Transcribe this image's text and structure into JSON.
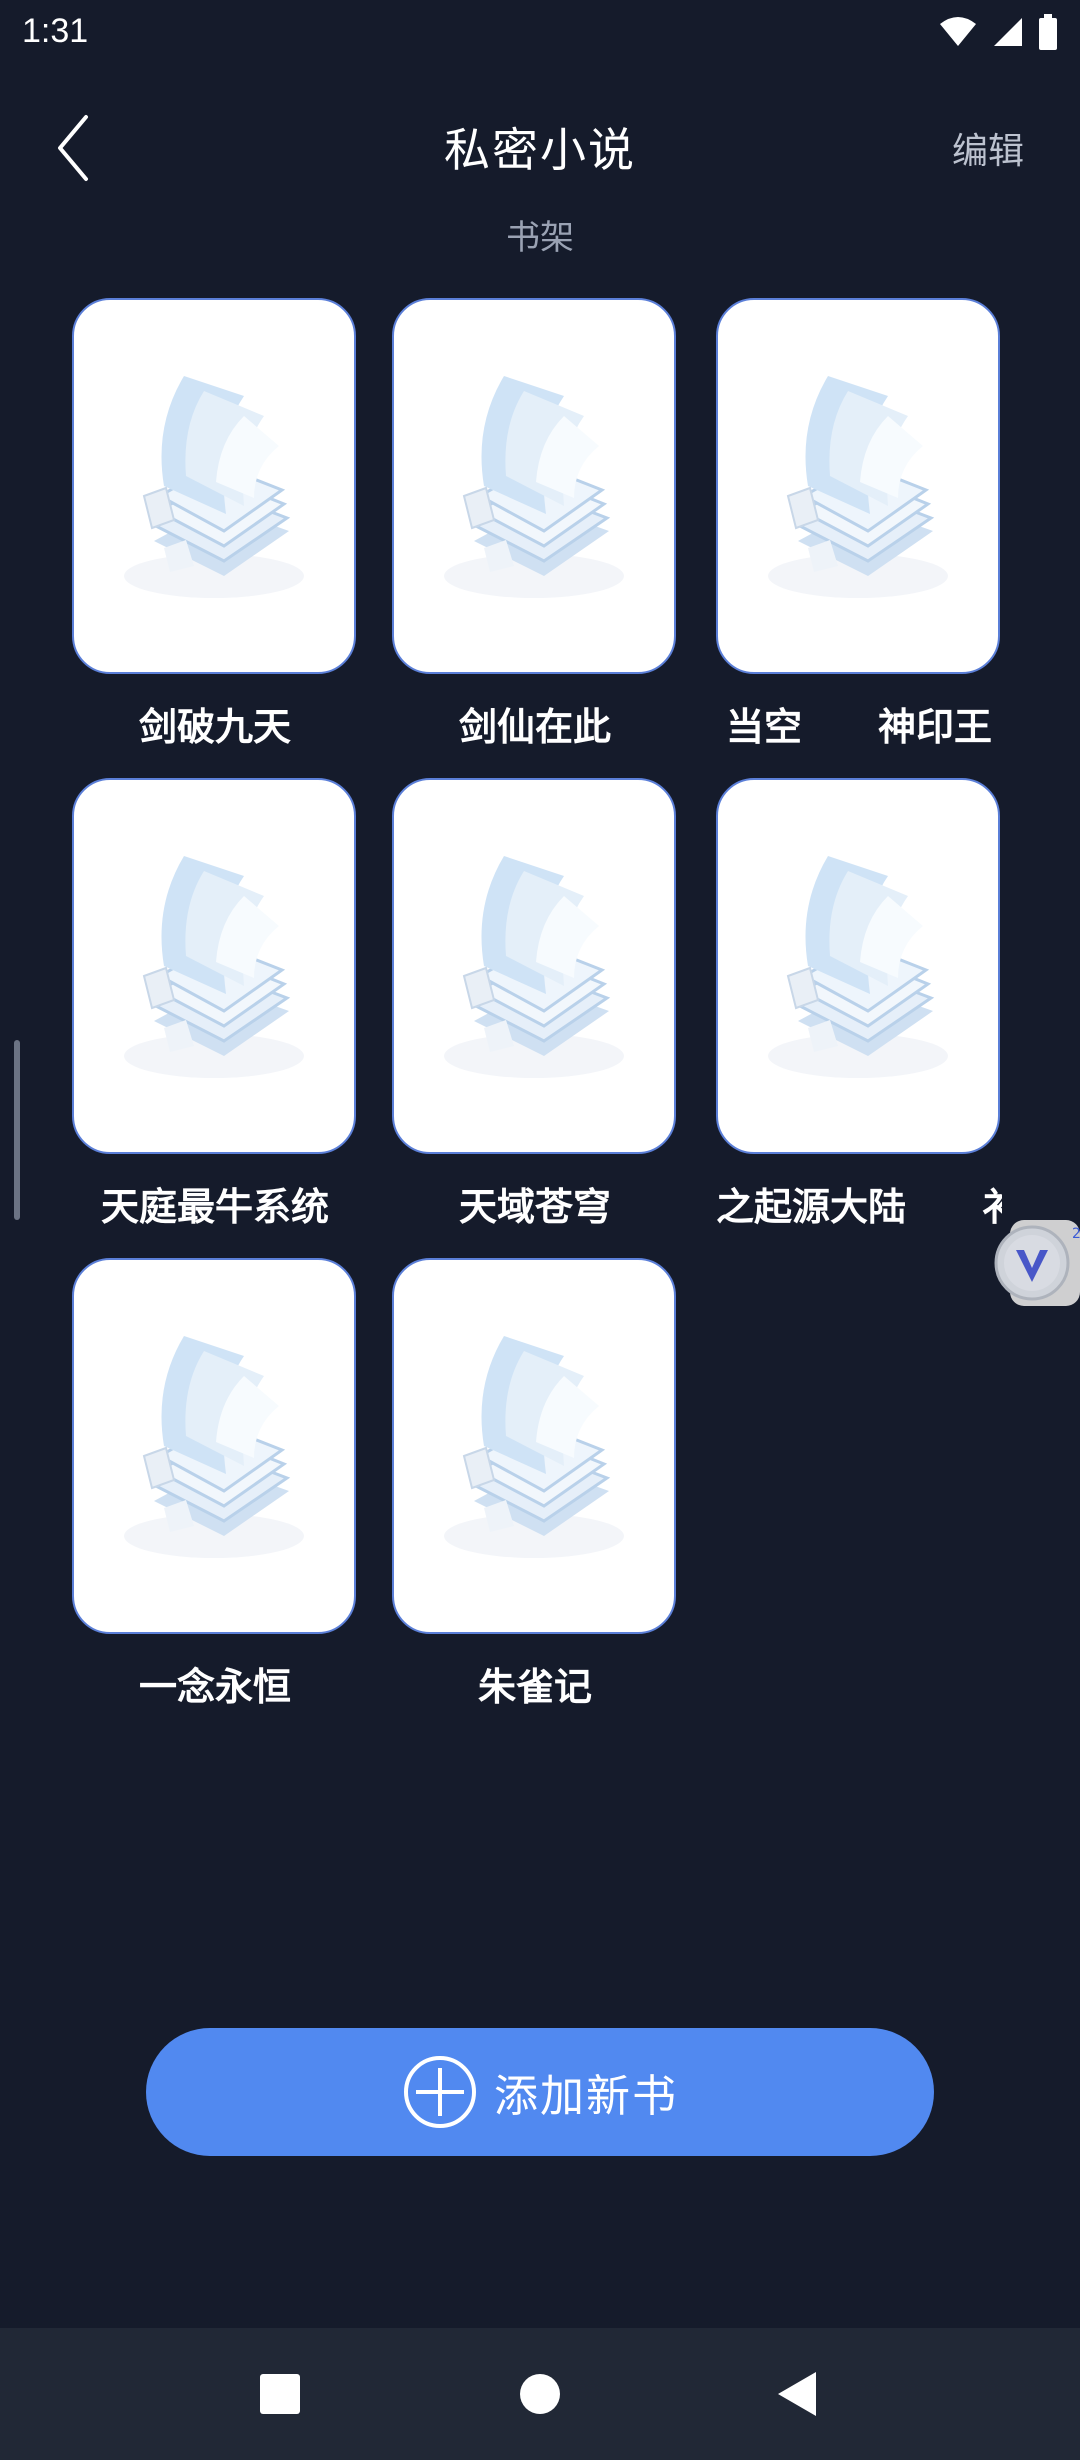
{
  "status_bar": {
    "time": "1:31",
    "icons": [
      "wifi-icon",
      "signal-icon",
      "battery-icon"
    ]
  },
  "header": {
    "back_icon": "chevron-left-icon",
    "title": "私密小说",
    "edit_label": "编辑"
  },
  "section": {
    "label": "书架"
  },
  "books": [
    {
      "title": "剑破九天"
    },
    {
      "title": "剑仙在此"
    },
    {
      "title": "当空　　神印王"
    },
    {
      "title": "天庭最牛系统"
    },
    {
      "title": "天域苍穹"
    },
    {
      "title": "之起源大陆　　衤"
    },
    {
      "title": "一念永恒"
    },
    {
      "title": "朱雀记"
    }
  ],
  "add_button": {
    "label": "添加新书",
    "icon": "plus-circle-icon"
  },
  "navigation": {
    "icons": [
      "recents-square-icon",
      "home-circle-icon",
      "back-triangle-icon"
    ]
  },
  "colors": {
    "background": "#151b2b",
    "accent": "#5189f0",
    "nav_bar": "#212836",
    "cover_border": "#5b7fd8"
  }
}
